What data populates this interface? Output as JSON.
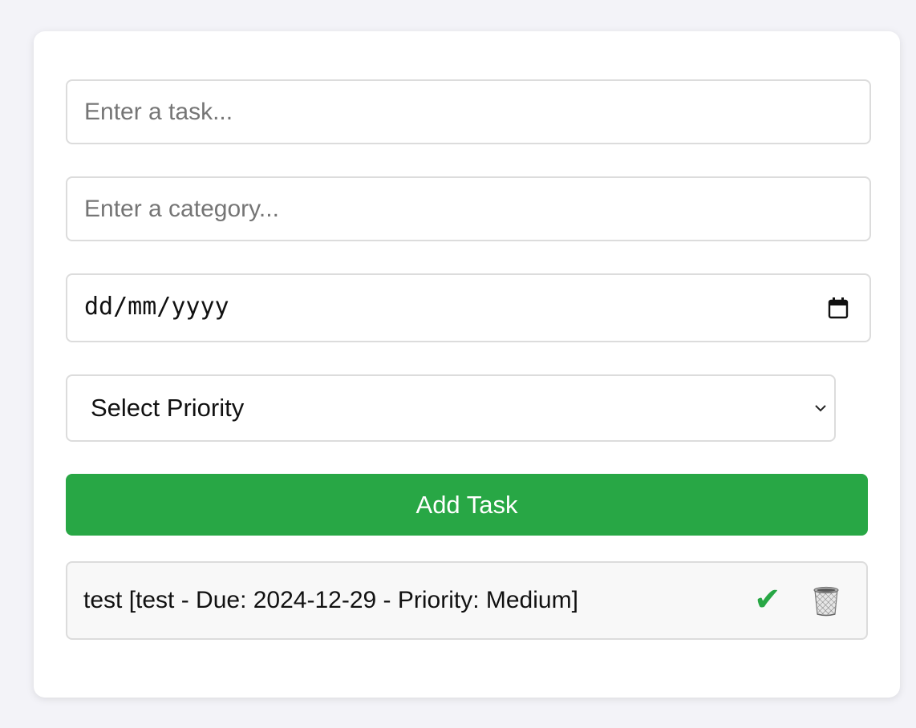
{
  "form": {
    "task_placeholder": "Enter a task...",
    "category_placeholder": "Enter a category...",
    "date_placeholder": "dd/mm/yyyy",
    "priority_selected": "Select Priority",
    "add_button_label": "Add Task"
  },
  "tasks": [
    {
      "text": "test [test - Due: 2024-12-29 - Priority: Medium]",
      "complete_icon": "check-icon",
      "delete_icon": "trash-icon"
    }
  ],
  "colors": {
    "accent": "#28a745",
    "background": "#f3f3f8",
    "card": "#ffffff",
    "border": "#dcdcdc",
    "task_background": "#f8f8f8"
  }
}
